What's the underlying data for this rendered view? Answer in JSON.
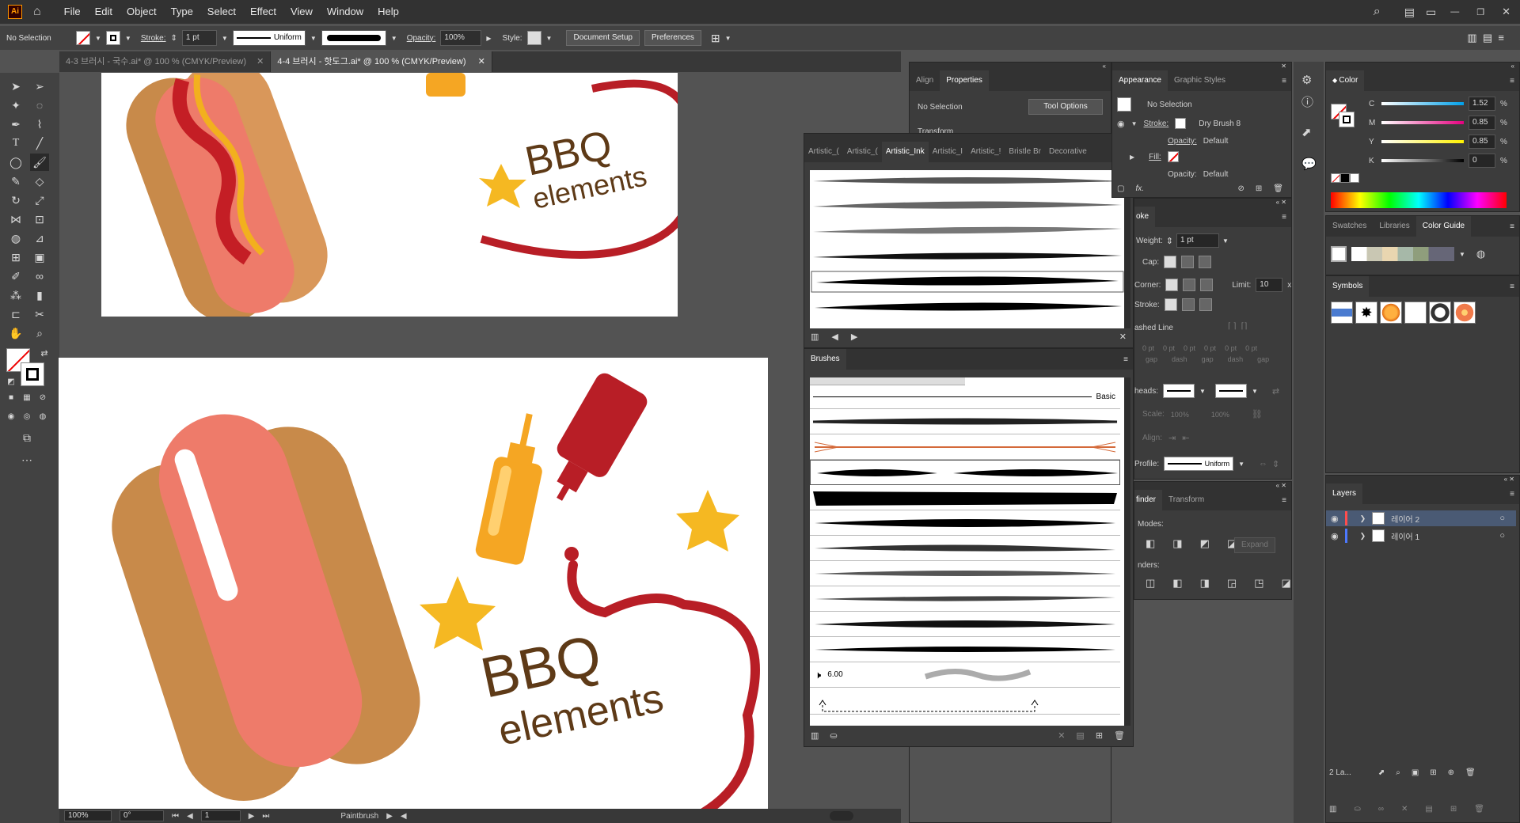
{
  "app": {
    "logo": "Ai"
  },
  "menu": [
    "File",
    "Edit",
    "Object",
    "Type",
    "Select",
    "Effect",
    "View",
    "Window",
    "Help"
  ],
  "control": {
    "selection": "No Selection",
    "stroke_label": "Stroke:",
    "stroke_weight": "1 pt",
    "profile": "Uniform",
    "opacity_label": "Opacity:",
    "opacity": "100%",
    "style_label": "Style:",
    "doc_setup": "Document Setup",
    "preferences": "Preferences"
  },
  "tabs": [
    {
      "label": "4-3 브러시 - 국수.ai* @ 100 % (CMYK/Preview)"
    },
    {
      "label": "4-4 브러시 - 핫도그.ai* @ 100 % (CMYK/Preview)"
    }
  ],
  "artwork": {
    "title": "BBQ",
    "subtitle": "elements"
  },
  "status": {
    "zoom": "100%",
    "angle": "0°",
    "artboard": "1",
    "tool": "Paintbrush"
  },
  "align_panel": {
    "tabs": [
      "Align",
      "Properties"
    ],
    "no_selection": "No Selection",
    "tool_options": "Tool Options",
    "transform": "Transform"
  },
  "artistic_ink": {
    "tabs": [
      "Artistic_(",
      "Artistic_(",
      "Artistic_Ink",
      "Artistic_I",
      "Artistic_!",
      "Bristle Br",
      "Decorative"
    ]
  },
  "brushes": {
    "title": "Brushes",
    "basic": "Basic",
    "size": "6.00"
  },
  "appearance": {
    "tabs": [
      "Appearance",
      "Graphic Styles"
    ],
    "no_selection": "No Selection",
    "stroke": "Stroke:",
    "brush": "Dry Brush 8",
    "opacity": "Opacity:",
    "opacity_value": "Default",
    "fill": "Fill:",
    "opacity2": "Opacity:",
    "opacity2_value": "Default",
    "fx": "fx."
  },
  "stroke": {
    "title": "oke",
    "weight_label": "Weight:",
    "weight": "1 pt",
    "cap": "Cap:",
    "corner": "Corner:",
    "limit_label": "Limit:",
    "limit": "10",
    "align": "Stroke:",
    "dashed": "ashed Line",
    "dash_vals": [
      "0 pt",
      "0 pt",
      "0 pt",
      "0 pt",
      "0 pt",
      "0 pt"
    ],
    "dash_lbls": [
      "gap",
      "dash",
      "gap",
      "dash",
      "gap"
    ],
    "arrowheads": "heads:",
    "scale": "Scale:",
    "scale_vals": [
      "100%",
      "100%"
    ],
    "align2": "Align:",
    "profile_label": "Profile:",
    "profile": "Uniform"
  },
  "pathfinder": {
    "tabs": [
      "finder",
      "Transform"
    ],
    "modes": "Modes:",
    "expand": "Expand",
    "finders": "nders:"
  },
  "color": {
    "title": "Color",
    "channels": [
      {
        "name": "C",
        "value": "1.52"
      },
      {
        "name": "M",
        "value": "0.85"
      },
      {
        "name": "Y",
        "value": "0.85"
      },
      {
        "name": "K",
        "value": "0"
      }
    ],
    "percent": "%"
  },
  "swatches": {
    "tabs": [
      "Swatches",
      "Libraries",
      "Color Guide"
    ]
  },
  "symbols": {
    "title": "Symbols"
  },
  "layers": {
    "title": "Layers",
    "items": [
      {
        "name": "레이어 2",
        "color": "#ff4d4d"
      },
      {
        "name": "레이어 1",
        "color": "#4d79ff"
      }
    ],
    "count": "2 La..."
  }
}
